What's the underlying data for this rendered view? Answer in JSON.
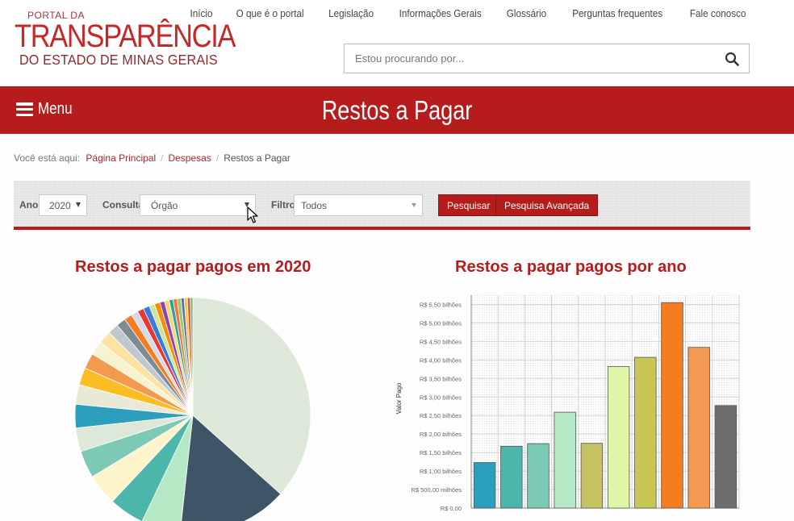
{
  "logo": {
    "line1": "PORTAL DA",
    "line2": "TRANSPARÊNCIA",
    "line3": "DO ESTADO DE MINAS GERAIS"
  },
  "nav": [
    "Início",
    "O que é o portal",
    "Legislação",
    "Informações Gerais",
    "Glossário",
    "Perguntas frequentes",
    "Fale conosco"
  ],
  "search": {
    "placeholder": "Estou procurando por...",
    "icon": "search-icon"
  },
  "menu": {
    "label": "Menu",
    "icon": "hamburger-icon"
  },
  "page_title": "Restos a Pagar",
  "breadcrumb": {
    "prefix": "Você está aqui:",
    "items": [
      "Página Principal",
      "Despesas",
      "Restos a Pagar"
    ]
  },
  "filters": {
    "ano_label": "Ano",
    "ano_value": "2020",
    "consulta_label": "Consulta",
    "consulta_value": "Órgão",
    "filtro_label": "Filtro",
    "filtro_value": "Todos",
    "btn_pesquisar": "Pesquisar",
    "btn_avancada": "Pesquisa Avançada"
  },
  "colors": {
    "brand": "#b71c1c"
  },
  "chart_data": [
    {
      "type": "pie",
      "title": "Restos a pagar pagos em 2020",
      "slices": [
        {
          "value": 34,
          "color": "#dde8d8"
        },
        {
          "value": 14,
          "color": "#3d5566"
        },
        {
          "value": 5,
          "color": "#b5e8c4"
        },
        {
          "value": 4.5,
          "color": "#4cb6aa"
        },
        {
          "value": 4,
          "color": "#fdf4cb"
        },
        {
          "value": 3.5,
          "color": "#7cc9b5"
        },
        {
          "value": 3,
          "color": "#dde8d8"
        },
        {
          "value": 3,
          "color": "#2e9ebd"
        },
        {
          "value": 2.5,
          "color": "#e8ead6"
        },
        {
          "value": 2.2,
          "color": "#fbbd24"
        },
        {
          "value": 2,
          "color": "#f29a4f"
        },
        {
          "value": 1.8,
          "color": "#f7f2d0"
        },
        {
          "value": 1.6,
          "color": "#fde3a1"
        },
        {
          "value": 1.4,
          "color": "#bfc8cf"
        },
        {
          "value": 1.2,
          "color": "#7d8c94"
        },
        {
          "value": 1.0,
          "color": "#f57c1f"
        },
        {
          "value": 0.9,
          "color": "#d9d9e8"
        },
        {
          "value": 0.8,
          "color": "#e53935"
        },
        {
          "value": 0.8,
          "color": "#3a7bd5"
        },
        {
          "value": 0.7,
          "color": "#c8e6a0"
        },
        {
          "value": 0.7,
          "color": "#fb8c00"
        },
        {
          "value": 0.6,
          "color": "#8e44ad"
        },
        {
          "value": 0.6,
          "color": "#f7d774"
        },
        {
          "value": 0.5,
          "color": "#26a69a"
        },
        {
          "value": 0.5,
          "color": "#ff7043"
        },
        {
          "value": 0.5,
          "color": "#9ccc65"
        },
        {
          "value": 0.4,
          "color": "#5c6bc0"
        },
        {
          "value": 0.4,
          "color": "#ffca28"
        },
        {
          "value": 0.4,
          "color": "#ef5350"
        },
        {
          "value": 0.3,
          "color": "#66bb6a"
        }
      ]
    },
    {
      "type": "bar",
      "title": "Restos a pagar pagos por ano",
      "ylabel": "Valor Pago",
      "ylim": [
        0,
        5.75
      ],
      "yticks": [
        {
          "v": 0,
          "label": "R$ 0,00"
        },
        {
          "v": 0.5,
          "label": "R$ 500,00 milhões"
        },
        {
          "v": 1.0,
          "label": "R$ 1,00 bilhões"
        },
        {
          "v": 1.5,
          "label": "R$ 1,50 bilhões"
        },
        {
          "v": 2.0,
          "label": "R$ 2,00 bilhões"
        },
        {
          "v": 2.5,
          "label": "R$ 2,50 bilhões"
        },
        {
          "v": 3.0,
          "label": "R$ 3,00 bilhões"
        },
        {
          "v": 3.5,
          "label": "R$ 3,50 bilhões"
        },
        {
          "v": 4.0,
          "label": "R$ 4,00 bilhões"
        },
        {
          "v": 4.5,
          "label": "R$ 4,50 bilhões"
        },
        {
          "v": 5.0,
          "label": "R$ 5,00 bilhões"
        },
        {
          "v": 5.5,
          "label": "R$ 5,50 bilhões"
        }
      ],
      "values": [
        1.23,
        1.67,
        1.74,
        2.59,
        1.75,
        3.82,
        4.07,
        5.55,
        4.34,
        2.77
      ],
      "colors": [
        "#2e9ebd",
        "#4cb6aa",
        "#7cc9b5",
        "#b5e8c4",
        "#c7c261",
        "#dff5a8",
        "#c9c655",
        "#f57c1f",
        "#f29a4f",
        "#6e6e6e"
      ]
    }
  ]
}
